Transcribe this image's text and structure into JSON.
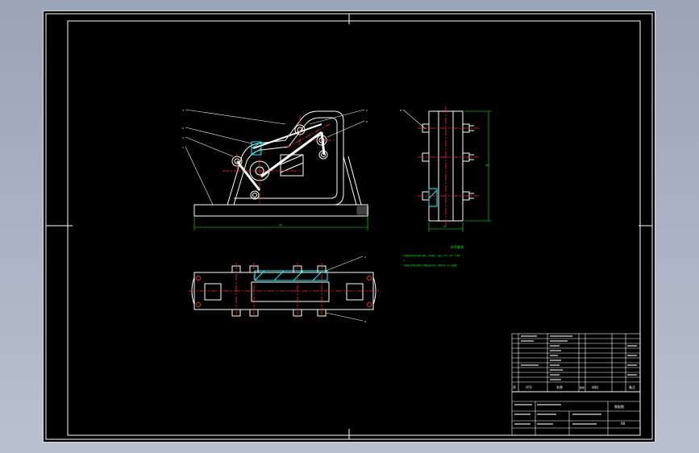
{
  "drawing": {
    "title": "装配图",
    "sheet_no": "08",
    "colors": {
      "outline": "#ffffff",
      "centerline": "#ff2a2a",
      "dimension": "#00ff00",
      "hatch": "#00ffff",
      "background": "#000000"
    }
  },
  "views": {
    "front": {
      "dimension_width": "80"
    },
    "side": {
      "dimension_width": "40",
      "dimension_height": "50"
    }
  },
  "callouts": [
    "1",
    "2",
    "3",
    "4",
    "5",
    "6",
    "7",
    "8"
  ],
  "notes": {
    "title": "技术要求",
    "lines": [
      "1.装配前所有零件进行清洗，去除毛刺、锐边，T10、T12、T16等",
      "2.",
      "3.装配后检查运动情况，确保运动灵活，间隙合适，无卡滞现象。"
    ]
  },
  "title_block": {
    "header": {
      "seq": "序",
      "code": "代号",
      "name": "名称",
      "qty": "数量",
      "material": "材料",
      "remark": "备注"
    },
    "drawing_name": "装配图",
    "drawing_no": "08"
  }
}
